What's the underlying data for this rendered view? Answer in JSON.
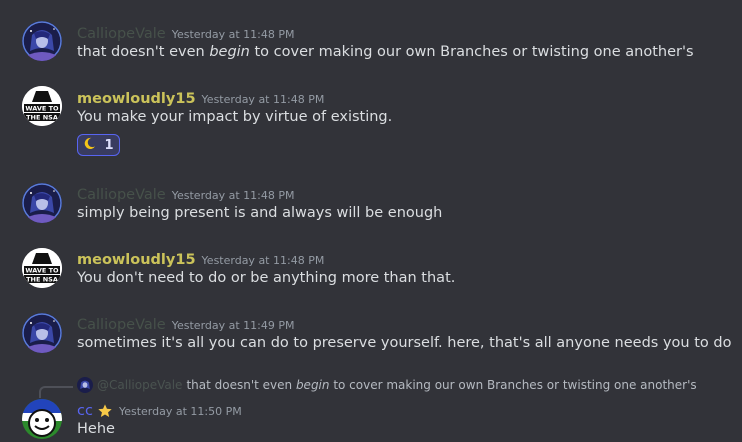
{
  "messages": [
    {
      "username": "CalliopeVale",
      "timestamp": "Yesterday at 11:48 PM",
      "text_before": "that doesn't even ",
      "text_em": "begin",
      "text_after": " to cover making our own Branches or twisting one another's"
    },
    {
      "username": "meowloudly15",
      "timestamp": "Yesterday at 11:48 PM",
      "text": "You make your impact by virtue of existing.",
      "avatar_text_1": "WAVE TO",
      "avatar_text_2": "THE NSA",
      "reaction": {
        "emoji": "crescent-moon",
        "count": "1"
      }
    },
    {
      "username": "CalliopeVale",
      "timestamp": "Yesterday at 11:48 PM",
      "text": "simply being present is and always will be enough"
    },
    {
      "username": "meowloudly15",
      "timestamp": "Yesterday at 11:48 PM",
      "text": "You don't need to do or be anything more than that.",
      "avatar_text_1": "WAVE TO",
      "avatar_text_2": "THE NSA"
    },
    {
      "username": "CalliopeVale",
      "timestamp": "Yesterday at 11:49 PM",
      "text": "sometimes it's all you can do to preserve yourself. here, that's all anyone needs you to do"
    },
    {
      "reply_to": {
        "mention": "@CalliopeVale",
        "text_before": "that doesn't even ",
        "text_em": "begin",
        "text_after": " to cover making our own Branches or twisting one another's"
      },
      "username": "cc",
      "timestamp": "Yesterday at 11:50 PM",
      "text": "Hehe",
      "badge": "star-icon"
    }
  ],
  "colors": {
    "background": "#323339",
    "calliope_name": "#46514a",
    "meow_name": "#cbc35a",
    "cc_name": "#5865f2",
    "reaction_border": "#5865f2"
  }
}
